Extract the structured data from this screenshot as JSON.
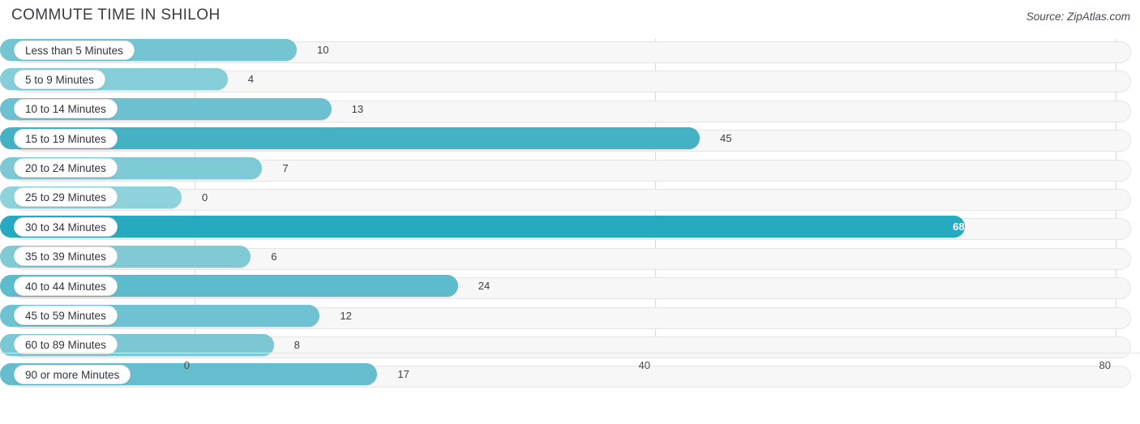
{
  "header": {
    "title": "COMMUTE TIME IN SHILOH",
    "source": "Source: ZipAtlas.com"
  },
  "chart_data": {
    "type": "bar",
    "orientation": "horizontal",
    "title": "COMMUTE TIME IN SHILOH",
    "xlabel": "",
    "ylabel": "",
    "xlim": [
      0,
      80
    ],
    "xticks": [
      0,
      40,
      80
    ],
    "xtick_labels": [
      "0",
      "40",
      "80"
    ],
    "grid": true,
    "legend": null,
    "categories": [
      "Less than 5 Minutes",
      "5 to 9 Minutes",
      "10 to 14 Minutes",
      "15 to 19 Minutes",
      "20 to 24 Minutes",
      "25 to 29 Minutes",
      "30 to 34 Minutes",
      "35 to 39 Minutes",
      "40 to 44 Minutes",
      "45 to 59 Minutes",
      "60 to 89 Minutes",
      "90 or more Minutes"
    ],
    "values": [
      10,
      4,
      13,
      45,
      7,
      0,
      68,
      6,
      24,
      12,
      8,
      17
    ],
    "value_labels": [
      "10",
      "4",
      "13",
      "45",
      "7",
      "0",
      "68",
      "6",
      "24",
      "12",
      "8",
      "17"
    ],
    "bars": [
      {
        "label": "Less than 5 Minutes",
        "value": 10,
        "value_label": "10",
        "color": "#74c4d2",
        "label_inside": false
      },
      {
        "label": "5 to 9 Minutes",
        "value": 4,
        "value_label": "4",
        "color": "#85cdd8",
        "label_inside": false
      },
      {
        "label": "10 to 14 Minutes",
        "value": 13,
        "value_label": "13",
        "color": "#6cc0d0",
        "label_inside": false
      },
      {
        "label": "15 to 19 Minutes",
        "value": 45,
        "value_label": "45",
        "color": "#44b2c4",
        "label_inside": false
      },
      {
        "label": "20 to 24 Minutes",
        "value": 7,
        "value_label": "7",
        "color": "#7dc9d5",
        "label_inside": false
      },
      {
        "label": "25 to 29 Minutes",
        "value": 0,
        "value_label": "0",
        "color": "#8ed2dc",
        "label_inside": false
      },
      {
        "label": "30 to 34 Minutes",
        "value": 68,
        "value_label": "68",
        "color": "#27a9c0",
        "label_inside": true
      },
      {
        "label": "35 to 39 Minutes",
        "value": 6,
        "value_label": "6",
        "color": "#80cad6",
        "label_inside": false
      },
      {
        "label": "40 to 44 Minutes",
        "value": 24,
        "value_label": "24",
        "color": "#5dbccb",
        "label_inside": false
      },
      {
        "label": "45 to 59 Minutes",
        "value": 12,
        "value_label": "12",
        "color": "#6fc2d1",
        "label_inside": false
      },
      {
        "label": "60 to 89 Minutes",
        "value": 8,
        "value_label": "8",
        "color": "#7bc8d4",
        "label_inside": false
      },
      {
        "label": "90 or more Minutes",
        "value": 17,
        "value_label": "17",
        "color": "#66bdce",
        "label_inside": false
      }
    ],
    "colors": {
      "accent_dark": "#27a9c0",
      "accent_light": "#8ed2dc",
      "track": "#f7f7f7",
      "track_border": "#e4e4e4",
      "gridline": "#d8d8d8",
      "text": "#3b3b46"
    }
  },
  "axis": {
    "ticks": [
      "0",
      "40",
      "80"
    ]
  }
}
